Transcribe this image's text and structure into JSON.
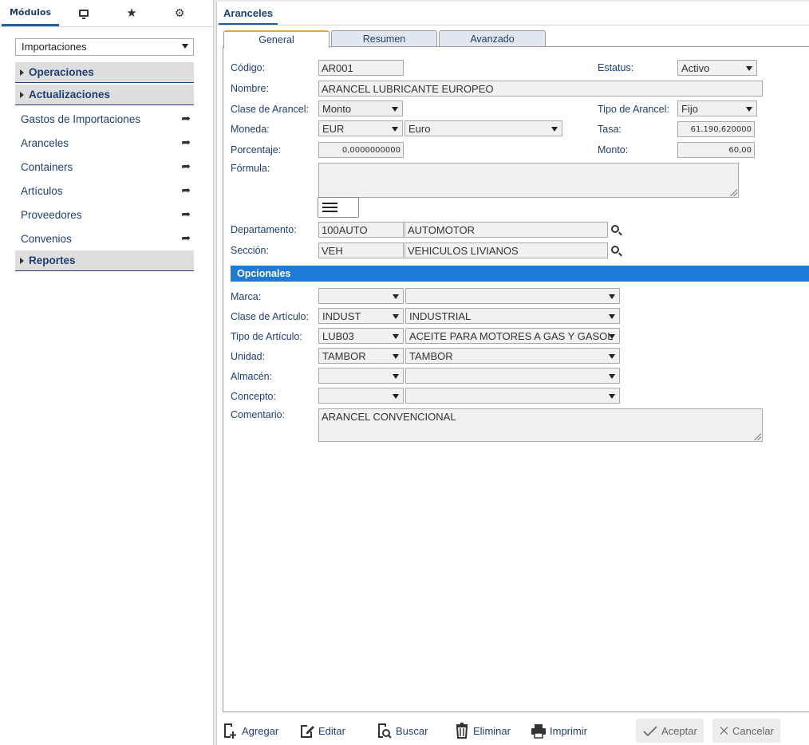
{
  "left_panel": {
    "tabs": {
      "modulos": "Módulos",
      "t2_icon": "monitor-icon",
      "t3_icon": "star-icon",
      "t4_icon": "gear-icon"
    },
    "module_select": "Importaciones",
    "sections": {
      "operaciones": "Operaciones",
      "actualizaciones": "Actualizaciones",
      "reportes": "Reportes"
    },
    "items": [
      "Gastos de Importaciones",
      "Aranceles",
      "Containers",
      "Artículos",
      "Proveedores",
      "Convenios"
    ]
  },
  "document": {
    "tab": "Aranceles",
    "subtabs": {
      "general": "General",
      "resumen": "Resumen",
      "avanzado": "Avanzado"
    },
    "labels": {
      "codigo": "Código:",
      "nombre": "Nombre:",
      "clase_arancel": "Clase de Arancel:",
      "moneda": "Moneda:",
      "porcentaje": "Porcentaje:",
      "formula": "Fórmula:",
      "departamento": "Departamento:",
      "seccion": "Sección:",
      "estatus": "Estatus:",
      "tipo_arancel": "Tipo de Arancel:",
      "tasa": "Tasa:",
      "monto": "Monto:"
    },
    "values": {
      "codigo": "AR001",
      "nombre": "ARANCEL LUBRICANTE EUROPEO",
      "clase_arancel": "Monto",
      "moneda_code": "EUR",
      "moneda_name": "Euro",
      "porcentaje": "0,0000000000",
      "formula": "",
      "departamento_code": "100AUTO",
      "departamento_name": "AUTOMOTOR",
      "seccion_code": "VEH",
      "seccion_name": "VEHICULOS LIVIANOS",
      "estatus": "Activo",
      "tipo_arancel": "Fijo",
      "tasa": "61.190,620000",
      "monto": "60,00"
    },
    "opcionales": {
      "title": "Opcionales",
      "labels": {
        "marca": "Marca:",
        "clase_articulo": "Clase de Artículo:",
        "tipo_articulo": "Tipo de Artículo:",
        "unidad": "Unidad:",
        "almacen": "Almacén:",
        "concepto": "Concepto:",
        "comentario": "Comentario:"
      },
      "values": {
        "marca_code": "",
        "marca_name": "",
        "clase_articulo_code": "INDUST",
        "clase_articulo_name": "INDUSTRIAL",
        "tipo_articulo_code": "LUB03",
        "tipo_articulo_name": "ACEITE PARA MOTORES A GAS Y GASOL",
        "unidad_code": "TAMBOR",
        "unidad_name": "TAMBOR",
        "almacen_code": "",
        "almacen_name": "",
        "concepto_code": "",
        "concepto_name": "",
        "comentario": "ARANCEL CONVENCIONAL"
      }
    }
  },
  "toolbar": {
    "agregar": "Agregar",
    "editar": "Editar",
    "buscar": "Buscar",
    "eliminar": "Eliminar",
    "imprimir": "Imprimir",
    "aceptar": "Aceptar",
    "cancelar": "Cancelar"
  },
  "colors": {
    "accent": "#1f3f73",
    "section_bar": "#1e7ad6",
    "active_tab_top": "#f0a030"
  }
}
